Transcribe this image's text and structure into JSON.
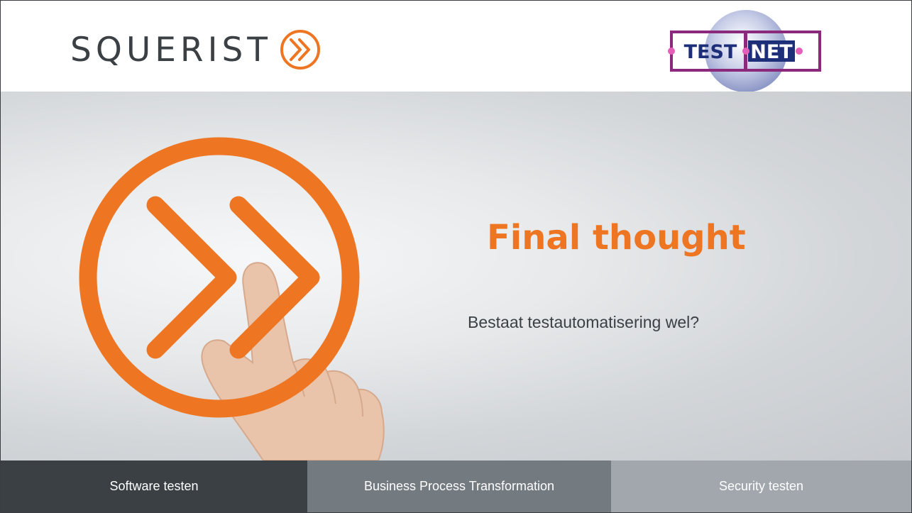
{
  "logos": {
    "squerist": "SQUERIST",
    "testnet_left": "TEST",
    "testnet_right": "NET"
  },
  "hero": {
    "title": "Final thought",
    "subtitle": "Bestaat testautomatisering wel?"
  },
  "footer": {
    "items": [
      "Software testen",
      "Business Process Transformation",
      "Security testen"
    ]
  },
  "colors": {
    "accent_orange": "#ee7623",
    "dark_gray": "#3b4045",
    "mid_gray": "#737a80",
    "light_gray": "#a1a7ad",
    "testnet_purple": "#8b2a7c",
    "testnet_navy": "#1e2f7a"
  },
  "icons": [
    "double-chevron-circle-icon",
    "pointing-hand-image"
  ]
}
